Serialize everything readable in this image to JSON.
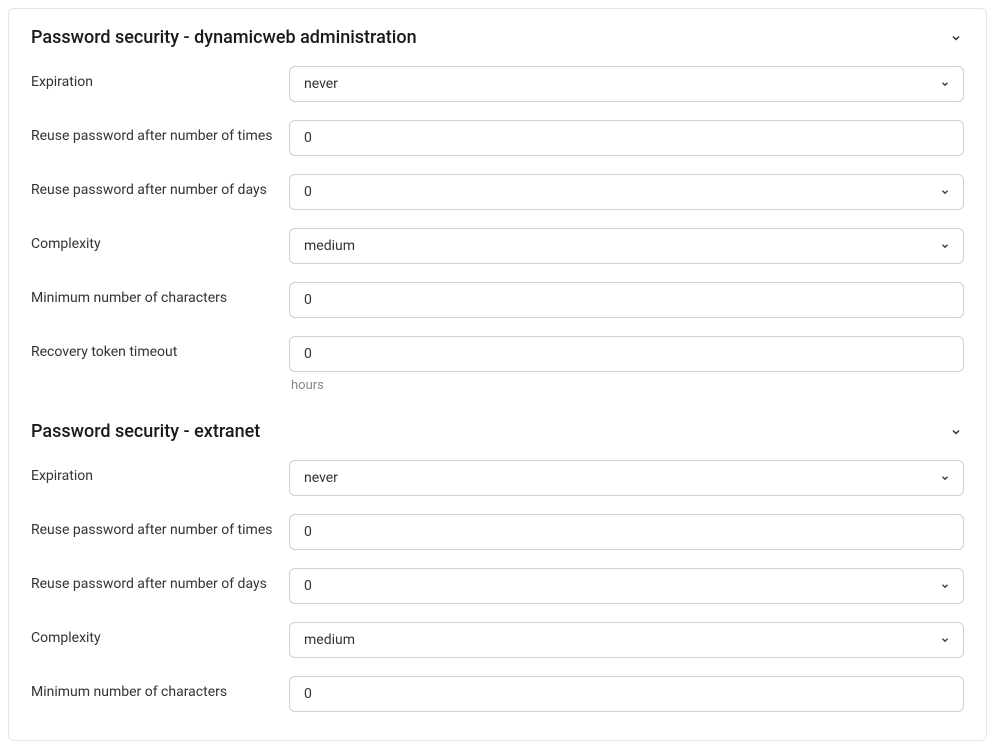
{
  "sections": {
    "admin": {
      "title": "Password security - dynamicweb administration",
      "fields": {
        "expiration": {
          "label": "Expiration",
          "value": "never"
        },
        "reuse_times": {
          "label": "Reuse password after number of times",
          "value": "0"
        },
        "reuse_days": {
          "label": "Reuse password after number of days",
          "value": "0"
        },
        "complexity": {
          "label": "Complexity",
          "value": "medium"
        },
        "min_chars": {
          "label": "Minimum number of characters",
          "value": "0"
        },
        "recovery_timeout": {
          "label": "Recovery token timeout",
          "value": "0",
          "helper": "hours"
        }
      }
    },
    "extranet": {
      "title": "Password security - extranet",
      "fields": {
        "expiration": {
          "label": "Expiration",
          "value": "never"
        },
        "reuse_times": {
          "label": "Reuse password after number of times",
          "value": "0"
        },
        "reuse_days": {
          "label": "Reuse password after number of days",
          "value": "0"
        },
        "complexity": {
          "label": "Complexity",
          "value": "medium"
        },
        "min_chars": {
          "label": "Minimum number of characters",
          "value": "0"
        }
      }
    }
  }
}
